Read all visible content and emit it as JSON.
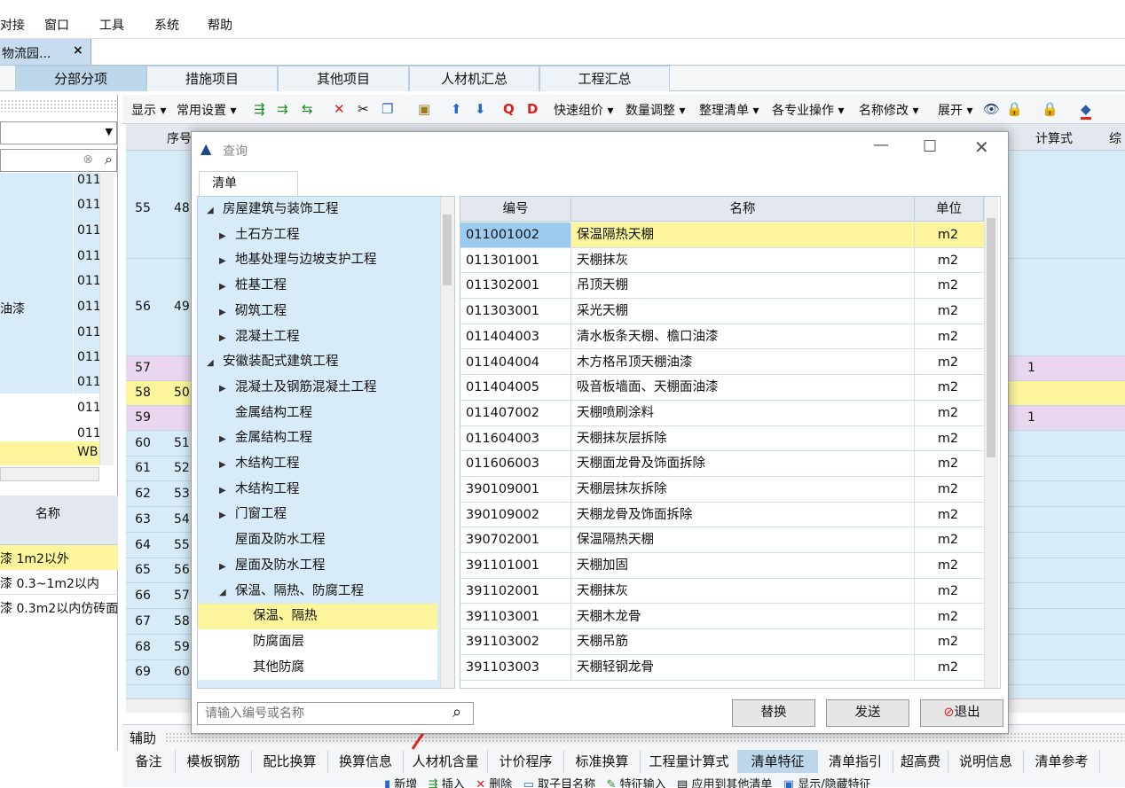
{
  "menu": [
    "对接",
    "窗口",
    "工具",
    "系统",
    "帮助"
  ],
  "doc_tab": {
    "label": "物流园...",
    "close": "×"
  },
  "module_tabs": [
    "分部分项",
    "措施项目",
    "其他项目",
    "人材机汇总",
    "工程汇总"
  ],
  "toolbar": {
    "display": "显示",
    "common_settings": "常用设置",
    "quick_group": "快速组价",
    "qty_adjust": "数量调整",
    "arrange_list": "整理清单",
    "specialty_ops": "各专业操作",
    "rename": "名称修改",
    "expand": "展开"
  },
  "left_panel": {
    "codes": [
      "011",
      "011",
      "011",
      "011",
      "011",
      "011",
      "011",
      "011",
      "011",
      "011",
      "011",
      "WB"
    ],
    "partial_text": "油漆",
    "name_header": "名称",
    "name_rows": [
      "漆 1m2以外",
      "漆 0.3~1m2以内",
      "漆 0.3m2以内仿砖面"
    ]
  },
  "main_grid": {
    "headers": {
      "seq": "序号",
      "calc": "计算式",
      "comp": "综"
    },
    "rows": [
      {
        "row": "55",
        "seq": "48"
      },
      {
        "row": "56",
        "seq": "49"
      },
      {
        "row": "57",
        "seq": "",
        "calc": "1"
      },
      {
        "row": "58",
        "seq": "50"
      },
      {
        "row": "59",
        "seq": "",
        "calc": "1"
      },
      {
        "row": "60",
        "seq": "51"
      },
      {
        "row": "61",
        "seq": "52"
      },
      {
        "row": "62",
        "seq": "53"
      },
      {
        "row": "63",
        "seq": "54"
      },
      {
        "row": "64",
        "seq": "55"
      },
      {
        "row": "65",
        "seq": "56"
      },
      {
        "row": "66",
        "seq": "57"
      },
      {
        "row": "67",
        "seq": "58"
      },
      {
        "row": "68",
        "seq": "59"
      },
      {
        "row": "69",
        "seq": "60"
      }
    ]
  },
  "aux": {
    "label": "辅助",
    "tabs": [
      "备注",
      "模板钢筋",
      "配比换算",
      "换算信息",
      "人材机含量",
      "计价程序",
      "标准换算",
      "工程量计算式",
      "清单特征",
      "清单指引",
      "超高费",
      "说明信息",
      "清单参考"
    ],
    "active_tab": "清单特征",
    "sub_buttons": [
      "新增",
      "插入",
      "删除",
      "取子目名称",
      "特征输入",
      "应用到其他清单",
      "显示/隐藏特征"
    ]
  },
  "dialog": {
    "title": "查询",
    "tab": "清单",
    "tree": [
      {
        "label": "房屋建筑与装饰工程",
        "level": 0,
        "arrow": "down"
      },
      {
        "label": "土石方工程",
        "level": 1,
        "arrow": "right"
      },
      {
        "label": "地基处理与边坡支护工程",
        "level": 1,
        "arrow": "right"
      },
      {
        "label": "桩基工程",
        "level": 1,
        "arrow": "right"
      },
      {
        "label": "砌筑工程",
        "level": 1,
        "arrow": "right"
      },
      {
        "label": "混凝土工程",
        "level": 1,
        "arrow": "right"
      },
      {
        "label": "安徽装配式建筑工程",
        "level": 0,
        "arrow": "down"
      },
      {
        "label": "混凝土及钢筋混凝土工程",
        "level": 1,
        "arrow": "right"
      },
      {
        "label": "金属结构工程",
        "level": 1,
        "arrow": ""
      },
      {
        "label": "金属结构工程",
        "level": 1,
        "arrow": "right"
      },
      {
        "label": "木结构工程",
        "level": 1,
        "arrow": "right"
      },
      {
        "label": "木结构工程",
        "level": 1,
        "arrow": "right"
      },
      {
        "label": "门窗工程",
        "level": 1,
        "arrow": "right"
      },
      {
        "label": "屋面及防水工程",
        "level": 1,
        "arrow": ""
      },
      {
        "label": "屋面及防水工程",
        "level": 1,
        "arrow": "right"
      },
      {
        "label": "保温、隔热、防腐工程",
        "level": 1,
        "arrow": "down"
      },
      {
        "label": "保温、隔热",
        "level": 2,
        "arrow": "",
        "selected": true
      },
      {
        "label": "防腐面层",
        "level": 2,
        "arrow": ""
      },
      {
        "label": "其他防腐",
        "level": 2,
        "arrow": ""
      }
    ],
    "table": {
      "headers": [
        "编号",
        "名称",
        "单位"
      ],
      "rows": [
        {
          "code": "011001002",
          "name": "保温隔热天棚",
          "unit": "m2",
          "selected": true
        },
        {
          "code": "011301001",
          "name": "天棚抹灰",
          "unit": "m2"
        },
        {
          "code": "011302001",
          "name": "吊顶天棚",
          "unit": "m2"
        },
        {
          "code": "011303001",
          "name": "采光天棚",
          "unit": "m2"
        },
        {
          "code": "011404003",
          "name": "清水板条天棚、檐口油漆",
          "unit": "m2"
        },
        {
          "code": "011404004",
          "name": "木方格吊顶天棚油漆",
          "unit": "m2"
        },
        {
          "code": "011404005",
          "name": "吸音板墙面、天棚面油漆",
          "unit": "m2"
        },
        {
          "code": "011407002",
          "name": "天棚喷刷涂料",
          "unit": "m2"
        },
        {
          "code": "011604003",
          "name": "天棚抹灰层拆除",
          "unit": "m2"
        },
        {
          "code": "011606003",
          "name": "天棚面龙骨及饰面拆除",
          "unit": "m2"
        },
        {
          "code": "390109001",
          "name": "天棚层抹灰拆除",
          "unit": "m2"
        },
        {
          "code": "390109002",
          "name": "天棚龙骨及饰面拆除",
          "unit": "m2"
        },
        {
          "code": "390702001",
          "name": "保温隔热天棚",
          "unit": "m2"
        },
        {
          "code": "391101001",
          "name": "天棚加固",
          "unit": "m2"
        },
        {
          "code": "391102001",
          "name": "天棚抹灰",
          "unit": "m2"
        },
        {
          "code": "391103001",
          "name": "天棚木龙骨",
          "unit": "m2"
        },
        {
          "code": "391103002",
          "name": "天棚吊筋",
          "unit": "m2"
        },
        {
          "code": "391103003",
          "name": "天棚轻钢龙骨",
          "unit": "m2"
        }
      ]
    },
    "search_placeholder": "请输入编号或名称",
    "buttons": {
      "replace": "替换",
      "send": "发送",
      "exit": "退出"
    }
  },
  "colors": {
    "accent_arrow": "#e8261c",
    "selected_row": "#fdf59b",
    "grid_bg": "#d7ecf8"
  }
}
